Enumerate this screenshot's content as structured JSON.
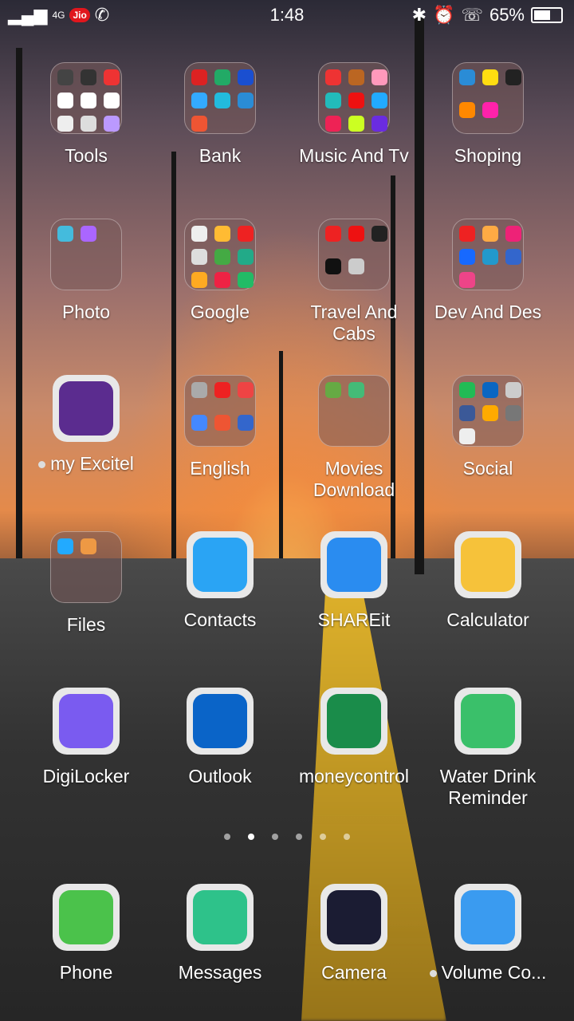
{
  "status_bar": {
    "time": "1:48",
    "carrier_badge": "Jio",
    "network_label": "4G",
    "battery_percent": "65%",
    "battery_level": 0.65
  },
  "pages": {
    "count": 6,
    "active_index": 1
  },
  "grid": [
    {
      "type": "folder",
      "label": "Tools",
      "colors": [
        "#444",
        "#333",
        "#e33",
        "#fff",
        "#fff",
        "#fff",
        "#eee",
        "#ddd",
        "#b9f"
      ]
    },
    {
      "type": "folder",
      "label": "Bank",
      "colors": [
        "#d22",
        "#2a6",
        "#1a4fd0",
        "#3af",
        "#2bd",
        "#2a8cd6",
        "#e53"
      ]
    },
    {
      "type": "folder",
      "label": "Music And Tv",
      "colors": [
        "#e33",
        "#b62",
        "#f9b",
        "#2bb",
        "#e11",
        "#2af",
        "#e25",
        "#cf2",
        "#6a2ce0"
      ]
    },
    {
      "type": "folder",
      "label": "Shoping",
      "colors": [
        "#2a8cd6",
        "#fd1",
        "#222",
        "#f80",
        "#f2a"
      ]
    },
    {
      "type": "folder",
      "label": "Photo",
      "colors": [
        "#4bd",
        "#a6f"
      ]
    },
    {
      "type": "folder",
      "label": "Google",
      "colors": [
        "#eee",
        "#fb3",
        "#e22",
        "#ddd",
        "#4a4",
        "#2a8",
        "#fa2",
        "#e24",
        "#2b6"
      ]
    },
    {
      "type": "folder",
      "label": "Travel And Cabs",
      "colors": [
        "#e22",
        "#e11",
        "#222",
        "#111",
        "#ccc"
      ]
    },
    {
      "type": "folder",
      "label": "Dev And Des",
      "colors": [
        "#e22",
        "#fa4",
        "#e27",
        "#1769ff",
        "#29c",
        "#36c",
        "#e48"
      ]
    },
    {
      "type": "app",
      "label": "my Excitel",
      "icon": "excitel-icon",
      "bg": "#5b2c8f",
      "notify": true
    },
    {
      "type": "folder",
      "label": "English",
      "colors": [
        "#aaa",
        "#e22",
        "#e44",
        "#48f",
        "#e53",
        "#36c"
      ]
    },
    {
      "type": "folder",
      "label": "Movies Download",
      "colors": [
        "#6a4",
        "#4b7"
      ]
    },
    {
      "type": "folder",
      "label": "Social",
      "colors": [
        "#2b5",
        "#0a66c2",
        "#ccc",
        "#3b5998",
        "#fa0",
        "#777",
        "#eee"
      ]
    },
    {
      "type": "folder",
      "label": "Files",
      "colors": [
        "#2af",
        "#e94"
      ]
    },
    {
      "type": "app",
      "label": "Contacts",
      "icon": "person-icon",
      "bg": "#2aa4f4"
    },
    {
      "type": "app",
      "label": "SHAREit",
      "icon": "shareit-icon",
      "bg": "#2a8cf0"
    },
    {
      "type": "app",
      "label": "Calculator",
      "icon": "calculator-icon",
      "bg": "#f6c23a"
    },
    {
      "type": "app",
      "label": "DigiLocker",
      "icon": "digilocker-icon",
      "bg": "#7a5bf0"
    },
    {
      "type": "app",
      "label": "Outlook",
      "icon": "outlook-icon",
      "bg": "#0a64c8"
    },
    {
      "type": "app",
      "label": "moneycontrol",
      "icon": "moneycontrol-icon",
      "bg": "#1a8c4a"
    },
    {
      "type": "app",
      "label": "Water Drink Reminder",
      "icon": "water-glass-icon",
      "bg": "#3ac06a"
    }
  ],
  "dock": [
    {
      "label": "Phone",
      "icon": "phone-dialer-icon",
      "bg": "#4bc24b"
    },
    {
      "label": "Messages",
      "icon": "chat-bubble-icon",
      "bg": "#2ec28a"
    },
    {
      "label": "Camera",
      "icon": "camera-lens-icon",
      "bg": "#1b1c33"
    },
    {
      "label": "Volume Co...",
      "icon": "volume-icon",
      "bg": "#3a9bf0",
      "notify": true
    }
  ]
}
